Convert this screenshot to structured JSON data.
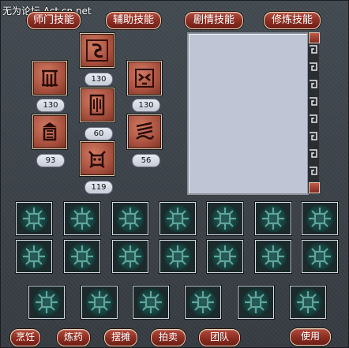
{
  "watermark": "无为论坛 Act.cn.net",
  "top_tabs": [
    {
      "label": "师门技能"
    },
    {
      "label": "辅助技能"
    },
    {
      "label": "剧情技能"
    },
    {
      "label": "修炼技能"
    }
  ],
  "skills": [
    {
      "icon": "scroll-rune-icon",
      "value": "130"
    },
    {
      "icon": "claw-rune-icon",
      "value": "130"
    },
    {
      "icon": "gate-rune-icon",
      "value": "60"
    },
    {
      "icon": "mask-rune-icon",
      "value": "130"
    },
    {
      "icon": "tower-rune-icon",
      "value": "93"
    },
    {
      "icon": "wave-rune-icon",
      "value": "56"
    },
    {
      "icon": "beast-rune-icon",
      "value": "119"
    }
  ],
  "bottom_buttons": [
    {
      "label": "烹饪"
    },
    {
      "label": "炼药"
    },
    {
      "label": "摆摊"
    },
    {
      "label": "拍卖"
    },
    {
      "label": "团队"
    },
    {
      "label": "使用"
    }
  ],
  "slot_icon": "jade-knot-icon",
  "colors": {
    "button_red": "#8a2d22",
    "panel_gray": "#c0c5d5",
    "skill_tile": "#a8503e",
    "slot_jade": "#295e5a"
  }
}
